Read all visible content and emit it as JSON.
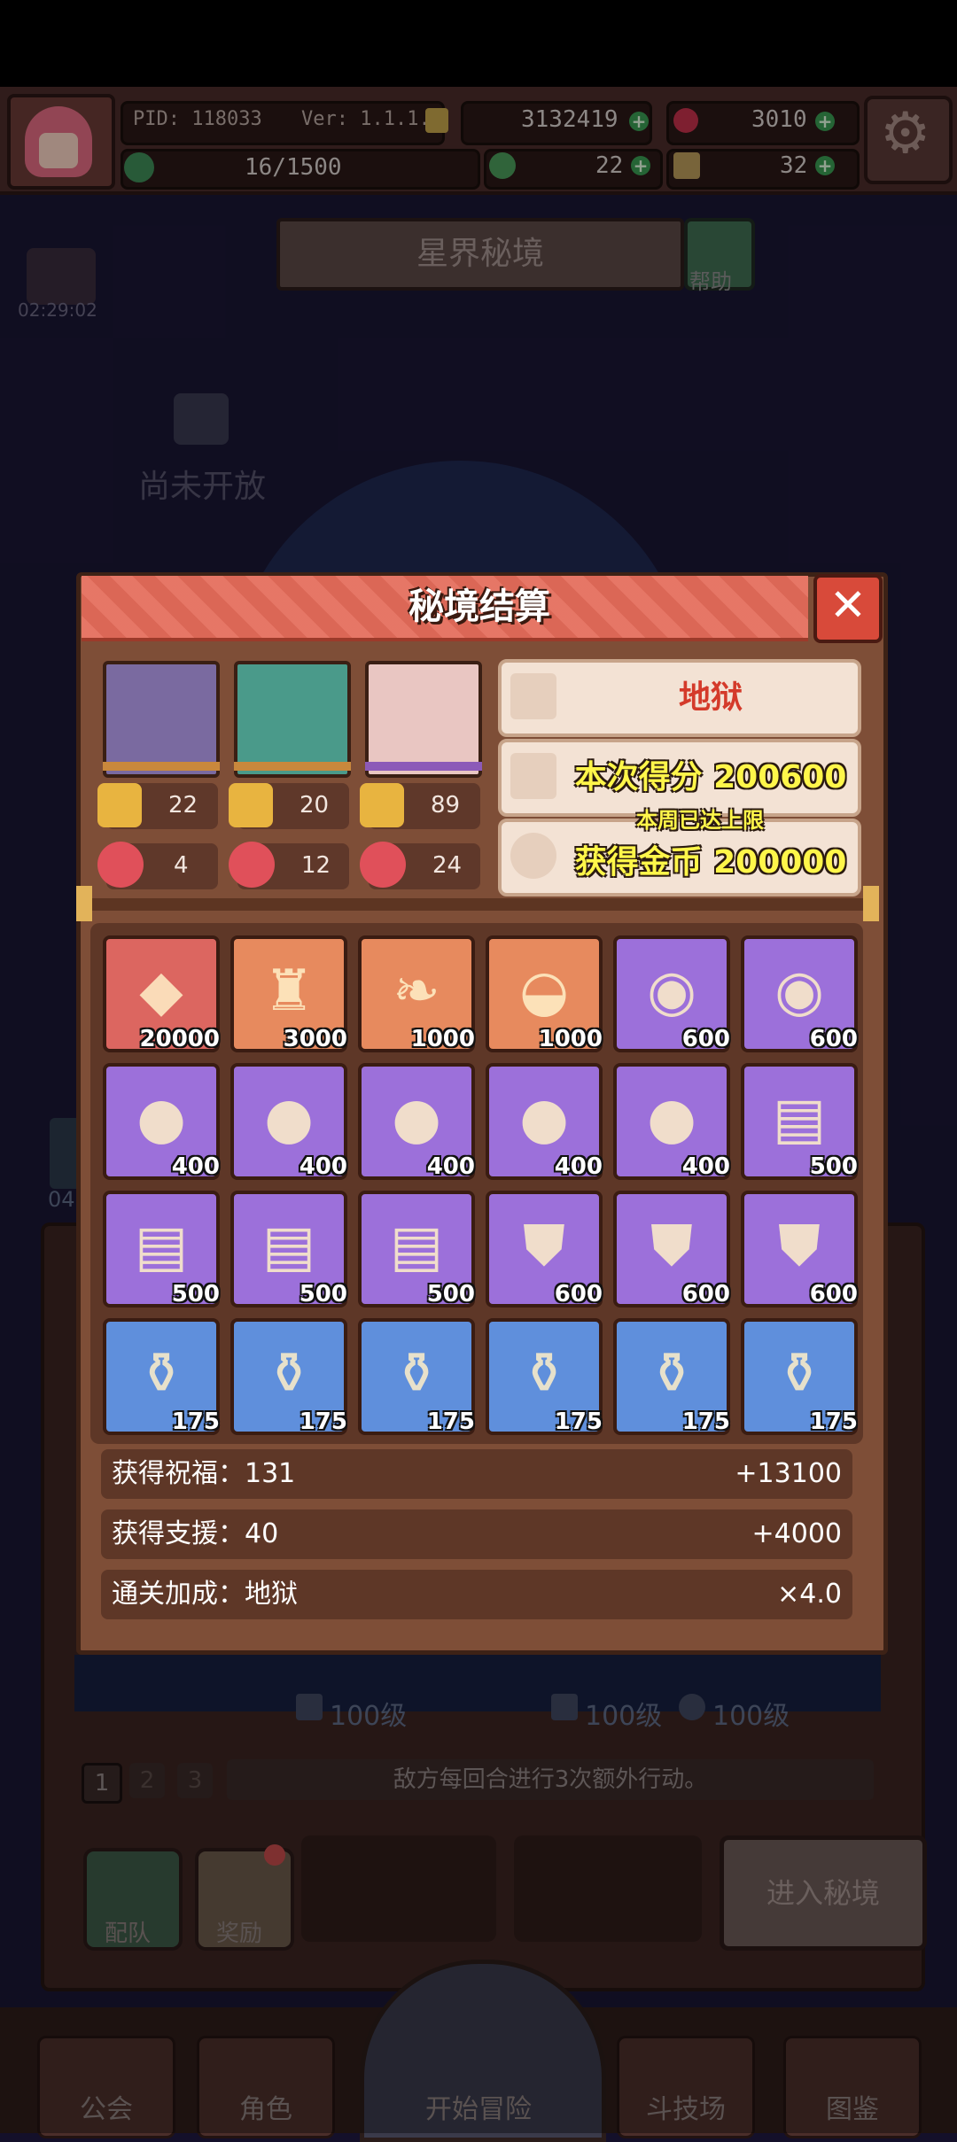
{
  "topbar": {
    "pid": "PID: 118033",
    "version": "Ver: 1.1.1.4",
    "coins": "3132419",
    "gems": "3010",
    "exp": "16/1500",
    "clover": "22",
    "key": "32"
  },
  "page": {
    "title": "星界秘境",
    "help_label": "帮助",
    "locked_text": "尚未开放",
    "timer": "02:29:02",
    "side_timer": "04"
  },
  "lower": {
    "levels": [
      "100级",
      "100级",
      "100级"
    ],
    "stages": [
      "1",
      "2",
      "3"
    ],
    "tip": "敌方每回合进行3次额外行动。",
    "team_label": "配队",
    "reward_label": "奖励",
    "enter_label": "进入秘境"
  },
  "nav": {
    "items": [
      "公会",
      "角色",
      "开始冒险",
      "斗技场",
      "图鉴"
    ]
  },
  "modal": {
    "title": "秘境结算",
    "close": "✕",
    "difficulty": "地狱",
    "score": "本次得分 200600",
    "weekly_limit": "本周已达上限",
    "gold": "获得金币 200000",
    "heroes": [
      {
        "trophy": "22",
        "medal": "4"
      },
      {
        "trophy": "20",
        "medal": "12"
      },
      {
        "trophy": "89",
        "medal": "24"
      }
    ],
    "items": [
      {
        "qty": "20000",
        "color": "red",
        "icon": "gold-ore-icon"
      },
      {
        "qty": "3000",
        "color": "orange",
        "icon": "armor-icon"
      },
      {
        "qty": "1000",
        "color": "orange",
        "icon": "feather-icon"
      },
      {
        "qty": "1000",
        "color": "orange",
        "icon": "shell-icon"
      },
      {
        "qty": "600",
        "color": "purple",
        "icon": "scroll-telescope-icon"
      },
      {
        "qty": "600",
        "color": "purple",
        "icon": "scroll-telescope-icon"
      },
      {
        "qty": "400",
        "color": "purple",
        "icon": "crystal-ball-icon"
      },
      {
        "qty": "400",
        "color": "purple",
        "icon": "crystal-ball-icon"
      },
      {
        "qty": "400",
        "color": "purple",
        "icon": "crystal-ball-icon"
      },
      {
        "qty": "400",
        "color": "purple",
        "icon": "crystal-ball-icon"
      },
      {
        "qty": "400",
        "color": "purple",
        "icon": "crystal-ball-icon"
      },
      {
        "qty": "500",
        "color": "purple",
        "icon": "map-scroll-icon"
      },
      {
        "qty": "500",
        "color": "purple",
        "icon": "map-scroll-icon"
      },
      {
        "qty": "500",
        "color": "purple",
        "icon": "map-scroll-icon"
      },
      {
        "qty": "500",
        "color": "purple",
        "icon": "map-scroll-icon"
      },
      {
        "qty": "600",
        "color": "purple",
        "icon": "shield-badge-icon"
      },
      {
        "qty": "600",
        "color": "purple",
        "icon": "shield-badge-icon"
      },
      {
        "qty": "600",
        "color": "purple",
        "icon": "shield-badge-icon"
      },
      {
        "qty": "175",
        "color": "blue",
        "icon": "potion-jar-icon"
      },
      {
        "qty": "175",
        "color": "blue",
        "icon": "potion-jar-icon"
      },
      {
        "qty": "175",
        "color": "blue",
        "icon": "potion-jar-icon"
      },
      {
        "qty": "175",
        "color": "blue",
        "icon": "potion-jar-icon"
      },
      {
        "qty": "175",
        "color": "blue",
        "icon": "potion-jar-icon"
      },
      {
        "qty": "175",
        "color": "blue",
        "icon": "potion-jar-icon"
      }
    ],
    "bonuses": [
      {
        "left": "获得祝福：131",
        "right": "+13100"
      },
      {
        "left": "获得支援：40",
        "right": "+4000"
      },
      {
        "left": "通关加成：地狱",
        "right": "×4.0"
      }
    ]
  }
}
